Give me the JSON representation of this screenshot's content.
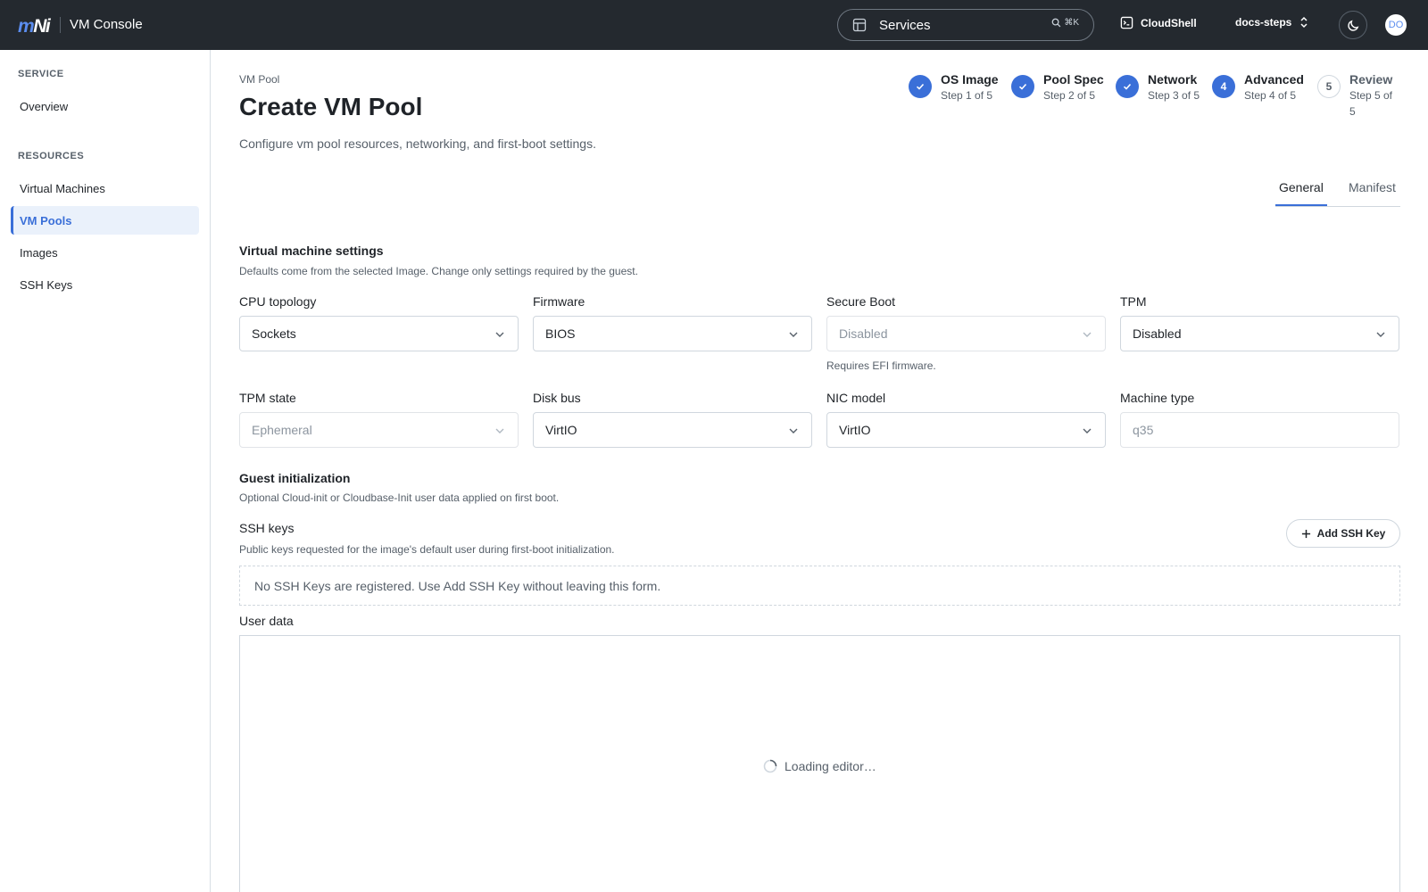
{
  "header": {
    "logo_m": "m",
    "logo_ni": "Ni",
    "app_title": "VM Console",
    "search_label": "Services",
    "search_shortcut": "⌘K",
    "cloudshell_label": "CloudShell",
    "project_label": "docs-steps",
    "avatar_initials": "DO"
  },
  "sidebar": {
    "service_heading": "SERVICE",
    "service_items": [
      {
        "label": "Overview"
      }
    ],
    "resources_heading": "RESOURCES",
    "resource_items": [
      {
        "label": "Virtual Machines"
      },
      {
        "label": "VM Pools",
        "active": true
      },
      {
        "label": "Images"
      },
      {
        "label": "SSH Keys"
      }
    ]
  },
  "page": {
    "breadcrumb": "VM Pool",
    "title": "Create VM Pool",
    "description": "Configure vm pool resources, networking, and first-boot settings."
  },
  "steps": [
    {
      "number": "1",
      "title": "OS Image",
      "subtitle": "Step 1 of 5",
      "state": "done"
    },
    {
      "number": "2",
      "title": "Pool Spec",
      "subtitle": "Step 2 of 5",
      "state": "done"
    },
    {
      "number": "3",
      "title": "Network",
      "subtitle": "Step 3 of 5",
      "state": "done"
    },
    {
      "number": "4",
      "title": "Advanced",
      "subtitle": "Step 4 of 5",
      "state": "current"
    },
    {
      "number": "5",
      "title": "Review",
      "subtitle": "Step 5 of 5",
      "state": "todo"
    }
  ],
  "tabs": [
    {
      "label": "General",
      "active": true
    },
    {
      "label": "Manifest"
    }
  ],
  "vm_settings": {
    "title": "Virtual machine settings",
    "description": "Defaults come from the selected Image. Change only settings required by the guest.",
    "cpu_topology": {
      "label": "CPU topology",
      "value": "Sockets"
    },
    "firmware": {
      "label": "Firmware",
      "value": "BIOS"
    },
    "secure_boot": {
      "label": "Secure Boot",
      "value": "Disabled",
      "helper": "Requires EFI firmware."
    },
    "tpm": {
      "label": "TPM",
      "value": "Disabled"
    },
    "tpm_state": {
      "label": "TPM state",
      "value": "Ephemeral"
    },
    "disk_bus": {
      "label": "Disk bus",
      "value": "VirtIO"
    },
    "nic_model": {
      "label": "NIC model",
      "value": "VirtIO"
    },
    "machine_type": {
      "label": "Machine type",
      "placeholder": "q35"
    }
  },
  "guest_init": {
    "title": "Guest initialization",
    "description": "Optional Cloud-init or Cloudbase-Init user data applied on first boot.",
    "ssh_keys_label": "SSH keys",
    "ssh_keys_description": "Public keys requested for the image's default user during first-boot initialization.",
    "add_ssh_key_label": "Add SSH Key",
    "empty_message": "No SSH Keys are registered. Use Add SSH Key without leaving this form.",
    "user_data_label": "User data",
    "editor_loading": "Loading editor…"
  },
  "colors": {
    "accent": "#3a6fd8",
    "topbar": "#24292f"
  }
}
